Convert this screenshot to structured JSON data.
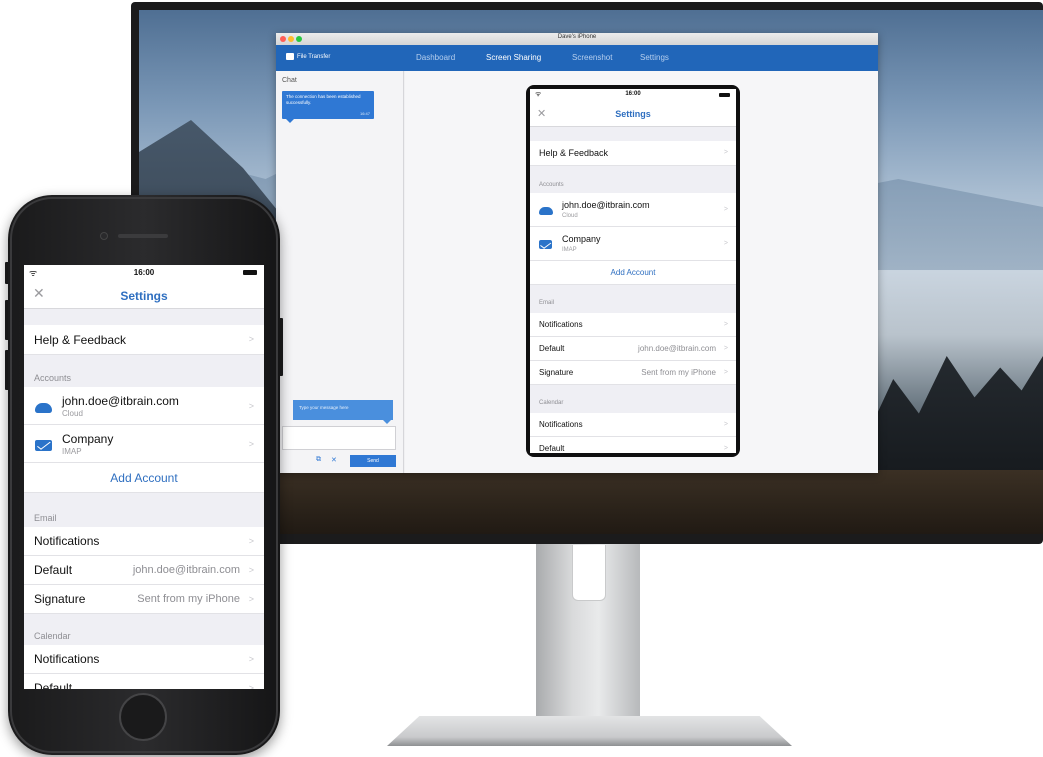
{
  "app": {
    "window_title": "Dave's iPhone",
    "brand": "File Transfer",
    "tabs": [
      {
        "label": "Dashboard",
        "active": false
      },
      {
        "label": "Screen Sharing",
        "active": true
      },
      {
        "label": "Screenshot",
        "active": false
      },
      {
        "label": "Settings",
        "active": false
      }
    ],
    "chat": {
      "title": "Chat",
      "received_message": "The connection has been established successfully.",
      "received_time": "16:47",
      "input_placeholder": "Type your message here",
      "send_label": "Send"
    },
    "colors": {
      "accent": "#2166b9",
      "bubble": "#2f78d4"
    }
  },
  "ios_settings": {
    "time": "16:00",
    "title": "Settings",
    "help_feedback": "Help & Feedback",
    "accounts_header": "Accounts",
    "accounts": [
      {
        "name": "john.doe@itbrain.com",
        "type": "Cloud",
        "icon": "cloud-icon"
      },
      {
        "name": "Company",
        "type": "IMAP",
        "icon": "mail-icon"
      }
    ],
    "add_account": "Add Account",
    "email_header": "Email",
    "email_rows": [
      {
        "label": "Notifications",
        "value": ""
      },
      {
        "label": "Default",
        "value": "john.doe@itbrain.com"
      },
      {
        "label": "Signature",
        "value": "Sent from my iPhone"
      }
    ],
    "calendar_header": "Calendar",
    "calendar_rows": [
      {
        "label": "Notifications",
        "value": ""
      },
      {
        "label": "Default",
        "value": ""
      }
    ],
    "chevron": ">",
    "close_glyph": "✕",
    "colors": {
      "link": "#2f6fc0"
    }
  }
}
